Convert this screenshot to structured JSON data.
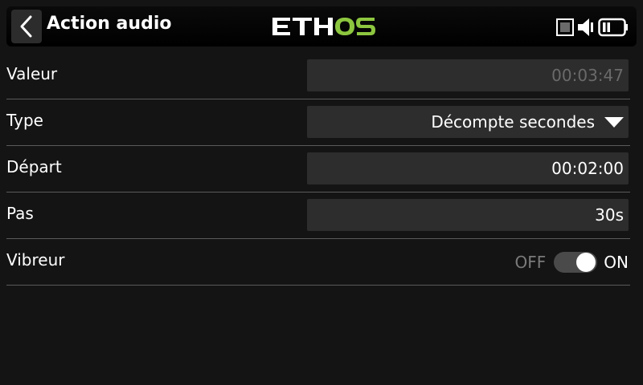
{
  "header": {
    "title": "Action audio",
    "logo_text": "ETHOS",
    "back_icon": "chevron-left-icon",
    "status_icons": [
      "sd-card-icon",
      "speaker-icon",
      "battery-icon"
    ],
    "colors": {
      "logo_white": "#ffffff",
      "logo_green": "#8dc63f"
    }
  },
  "rows": [
    {
      "label": "Valeur",
      "value": "00:03:47",
      "kind": "readonly"
    },
    {
      "label": "Type",
      "value": "Décompte secondes",
      "kind": "dropdown"
    },
    {
      "label": "Départ",
      "value": "00:02:00",
      "kind": "field"
    },
    {
      "label": "Pas",
      "value": "30s",
      "kind": "field"
    },
    {
      "label": "Vibreur",
      "kind": "toggle",
      "off_label": "OFF",
      "on_label": "ON",
      "state": "on"
    }
  ]
}
